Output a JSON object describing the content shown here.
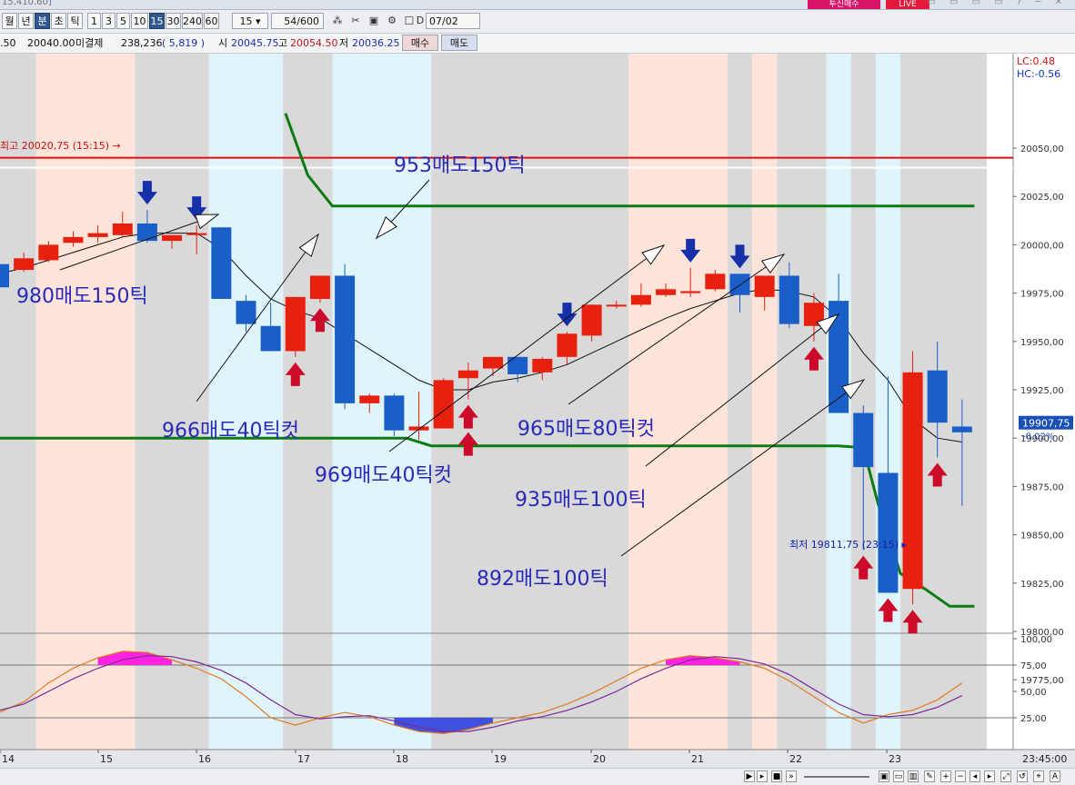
{
  "window": {
    "title": "15,410.60]",
    "badge_left": "투신매수",
    "badge_right": "LIVE"
  },
  "toolbar": {
    "period_buttons": [
      "월",
      "년",
      "분",
      "초",
      "틱",
      "1",
      "3",
      "5",
      "10",
      "15",
      "30",
      "240",
      "60"
    ],
    "active_buttons": [
      "분",
      "15"
    ],
    "interval_value": "15",
    "count_value": "54",
    "count_total": "/600",
    "date_checkbox_label": "D",
    "date_value": "07/02"
  },
  "info": {
    "prev_price": ".50",
    "current_price": "20040.00",
    "open_interest_label": "미결제",
    "open_interest": "238,236",
    "oi_change": "( 5,819 )",
    "open_label": "시",
    "open": "20045.75",
    "high_label": "고",
    "high": "20054.50",
    "low_label": "저",
    "low": "20036.25",
    "buy_button": "매수",
    "sell_button": "매도"
  },
  "colors": {
    "up": "#e8200f",
    "down": "#1a5fc8",
    "support": "#0e7a14",
    "hline_red": "#e01010",
    "arrow_down": "#1530a8",
    "arrow_up": "#cc0a2a",
    "ma": "#111111",
    "stoch_k": "#e07a20",
    "stoch_d": "#7a2a9a",
    "overbought_fill": "#ff22e0",
    "oversold_fill": "#4050e0"
  },
  "chart_data": {
    "type": "candlestick",
    "ylim": [
      19765,
      20065
    ],
    "yticks": [
      "20050,00",
      "20025,00",
      "20000,00",
      "19975,00",
      "19950,00",
      "19925,00",
      "19900,00",
      "19875,00",
      "19850,00",
      "19825,00",
      "19800,00",
      "19775,00"
    ],
    "ytick_values": [
      20050,
      20025,
      20000,
      19975,
      19950,
      19925,
      19900,
      19875,
      19850,
      19825,
      19800,
      19775
    ],
    "xticks": [
      "14",
      "15",
      "16",
      "17",
      "18",
      "19",
      "20",
      "21",
      "22",
      "23"
    ],
    "time_label": "23:45:00",
    "lc_label": "LC:0.48",
    "hc_label": "HC:-0.56",
    "last_price_label": "19907,75",
    "last_change_label": "-0.02%",
    "last_price": 19907.75,
    "high_marker": "최고 20020,75 (15:15)",
    "low_marker": "최저 19811,75 (23:15)",
    "red_line": 20045,
    "candles": [
      [
        19990,
        19995,
        19977,
        19978
      ],
      [
        19987,
        19996,
        19986,
        19993
      ],
      [
        19992,
        20002,
        19991,
        20000
      ],
      [
        20001,
        20007,
        19999,
        20004
      ],
      [
        20004,
        20010,
        20001,
        20006
      ],
      [
        20005,
        20017,
        20004,
        20011
      ],
      [
        20011,
        20018,
        20001,
        20002
      ],
      [
        20002,
        20005,
        19998,
        20005
      ],
      [
        20005,
        20010,
        19995,
        20006
      ],
      [
        20009,
        20009,
        19973,
        19972
      ],
      [
        19971,
        19974,
        19955,
        19959
      ],
      [
        19958,
        19970,
        19945,
        19945
      ],
      [
        19945,
        19972,
        19942,
        19973
      ],
      [
        19972,
        19984,
        19970,
        19984
      ],
      [
        19984,
        19990,
        19915,
        19918
      ],
      [
        19918,
        19923,
        19913,
        19922
      ],
      [
        19922,
        19923,
        19901,
        19904
      ],
      [
        19904,
        19924,
        19899,
        19906
      ],
      [
        19905,
        19931,
        19905,
        19930
      ],
      [
        19931,
        19939,
        19920,
        19935
      ],
      [
        19936,
        19942,
        19932,
        19942
      ],
      [
        19942,
        19942,
        19929,
        19933
      ],
      [
        19934,
        19942,
        19930,
        19941
      ],
      [
        19942,
        19955,
        19938,
        19954
      ],
      [
        19953,
        19969,
        19950,
        19969
      ],
      [
        19969,
        19971,
        19967,
        19969
      ],
      [
        19969,
        19980,
        19968,
        19974
      ],
      [
        19974,
        19980,
        19973,
        19977
      ],
      [
        19975,
        19988,
        19973,
        19976
      ],
      [
        19977,
        19987,
        19976,
        19985
      ],
      [
        19985,
        19985,
        19965,
        19974
      ],
      [
        19973,
        19983,
        19966,
        19984
      ],
      [
        19984,
        19991,
        19957,
        19959
      ],
      [
        19958,
        19975,
        19950,
        19970
      ],
      [
        19971,
        19985,
        19914,
        19913
      ],
      [
        19913,
        19917,
        19842,
        19885
      ],
      [
        19882,
        19932,
        19820,
        19820
      ],
      [
        19822,
        19945,
        19814,
        19934
      ],
      [
        19935,
        19950,
        19890,
        19908
      ],
      [
        19906,
        19920,
        19865,
        19903
      ]
    ],
    "ma_values": [
      19985,
      19988,
      19992,
      19996,
      20000,
      20004,
      20006,
      20006,
      20006,
      19998,
      19984,
      19972,
      19966,
      19962,
      19954,
      19946,
      19938,
      19930,
      19925,
      19925,
      19929,
      19931,
      19934,
      19938,
      19944,
      19950,
      19956,
      19962,
      19967,
      19971,
      19975,
      19977,
      19976,
      19973,
      19962,
      19944,
      19930,
      19910,
      19900,
      19898
    ],
    "support_line": [
      [
        -0.5,
        19900
      ],
      [
        7.5,
        19900
      ],
      [
        16.5,
        19900
      ],
      [
        17.5,
        19896
      ],
      [
        18.5,
        19896
      ],
      [
        34,
        19896
      ],
      [
        35,
        19895
      ],
      [
        35.6,
        19866
      ],
      [
        36.5,
        19830
      ],
      [
        37.5,
        19822
      ],
      [
        38.5,
        19813
      ],
      [
        39.5,
        19813
      ]
    ],
    "upper_line": [
      [
        11.6,
        20068
      ],
      [
        12.5,
        20036
      ],
      [
        13.5,
        20020
      ],
      [
        39.5,
        20020
      ]
    ],
    "bands": [
      {
        "from": 1.5,
        "to": 5.5,
        "color": "#ffe4da"
      },
      {
        "from": 5.5,
        "to": 8.5,
        "color": "#d9d9d9"
      },
      {
        "from": 8.5,
        "to": 11.5,
        "color": "#e0f4fc"
      },
      {
        "from": 11.5,
        "to": 13.5,
        "color": "#d9d9d9"
      },
      {
        "from": 13.5,
        "to": 17.5,
        "color": "#e0f4fc"
      },
      {
        "from": 17.5,
        "to": 25.5,
        "color": "#d9d9d9"
      },
      {
        "from": 25.5,
        "to": 29.5,
        "color": "#ffe4da"
      },
      {
        "from": 29.5,
        "to": 30.5,
        "color": "#d9d9d9"
      },
      {
        "from": 30.5,
        "to": 31.5,
        "color": "#ffe4da"
      },
      {
        "from": 31.5,
        "to": 33.5,
        "color": "#d9d9d9"
      },
      {
        "from": 33.5,
        "to": 34.5,
        "color": "#e0f4fc"
      },
      {
        "from": 34.5,
        "to": 35.5,
        "color": "#d9d9d9"
      },
      {
        "from": 35.5,
        "to": 36.5,
        "color": "#e0f4fc"
      },
      {
        "from": 36.5,
        "to": 40,
        "color": "#d9d9d9"
      },
      {
        "from": -0.5,
        "to": 1.5,
        "color": "#d9d9d9"
      }
    ],
    "down_arrows": [
      6,
      8,
      23,
      28,
      30
    ],
    "up_arrows": [
      12,
      13,
      19,
      19.01,
      33,
      35,
      36,
      37,
      38
    ],
    "stoch_ticks": [
      "100,00",
      "75,00",
      "50,00",
      "25,00"
    ],
    "stoch_k": [
      30,
      40,
      58,
      72,
      82,
      88,
      87,
      80,
      72,
      62,
      45,
      25,
      18,
      25,
      30,
      26,
      18,
      12,
      10,
      14,
      20,
      25,
      30,
      38,
      48,
      60,
      72,
      80,
      84,
      82,
      78,
      72,
      60,
      45,
      30,
      20,
      28,
      32,
      42,
      58
    ],
    "stoch_d": [
      32,
      38,
      50,
      62,
      72,
      80,
      84,
      83,
      78,
      70,
      58,
      42,
      28,
      24,
      26,
      27,
      22,
      16,
      12,
      12,
      16,
      22,
      26,
      32,
      40,
      50,
      62,
      72,
      80,
      83,
      81,
      76,
      66,
      52,
      38,
      28,
      26,
      28,
      35,
      46
    ]
  },
  "annotations": [
    {
      "text": "953매도150틱"
    },
    {
      "text": "980매도150틱"
    },
    {
      "text": "966매도40틱컷"
    },
    {
      "text": "969매도40틱컷"
    },
    {
      "text": "965매도80틱컷"
    },
    {
      "text": "935매도100틱"
    },
    {
      "text": "892매도100틱"
    }
  ]
}
